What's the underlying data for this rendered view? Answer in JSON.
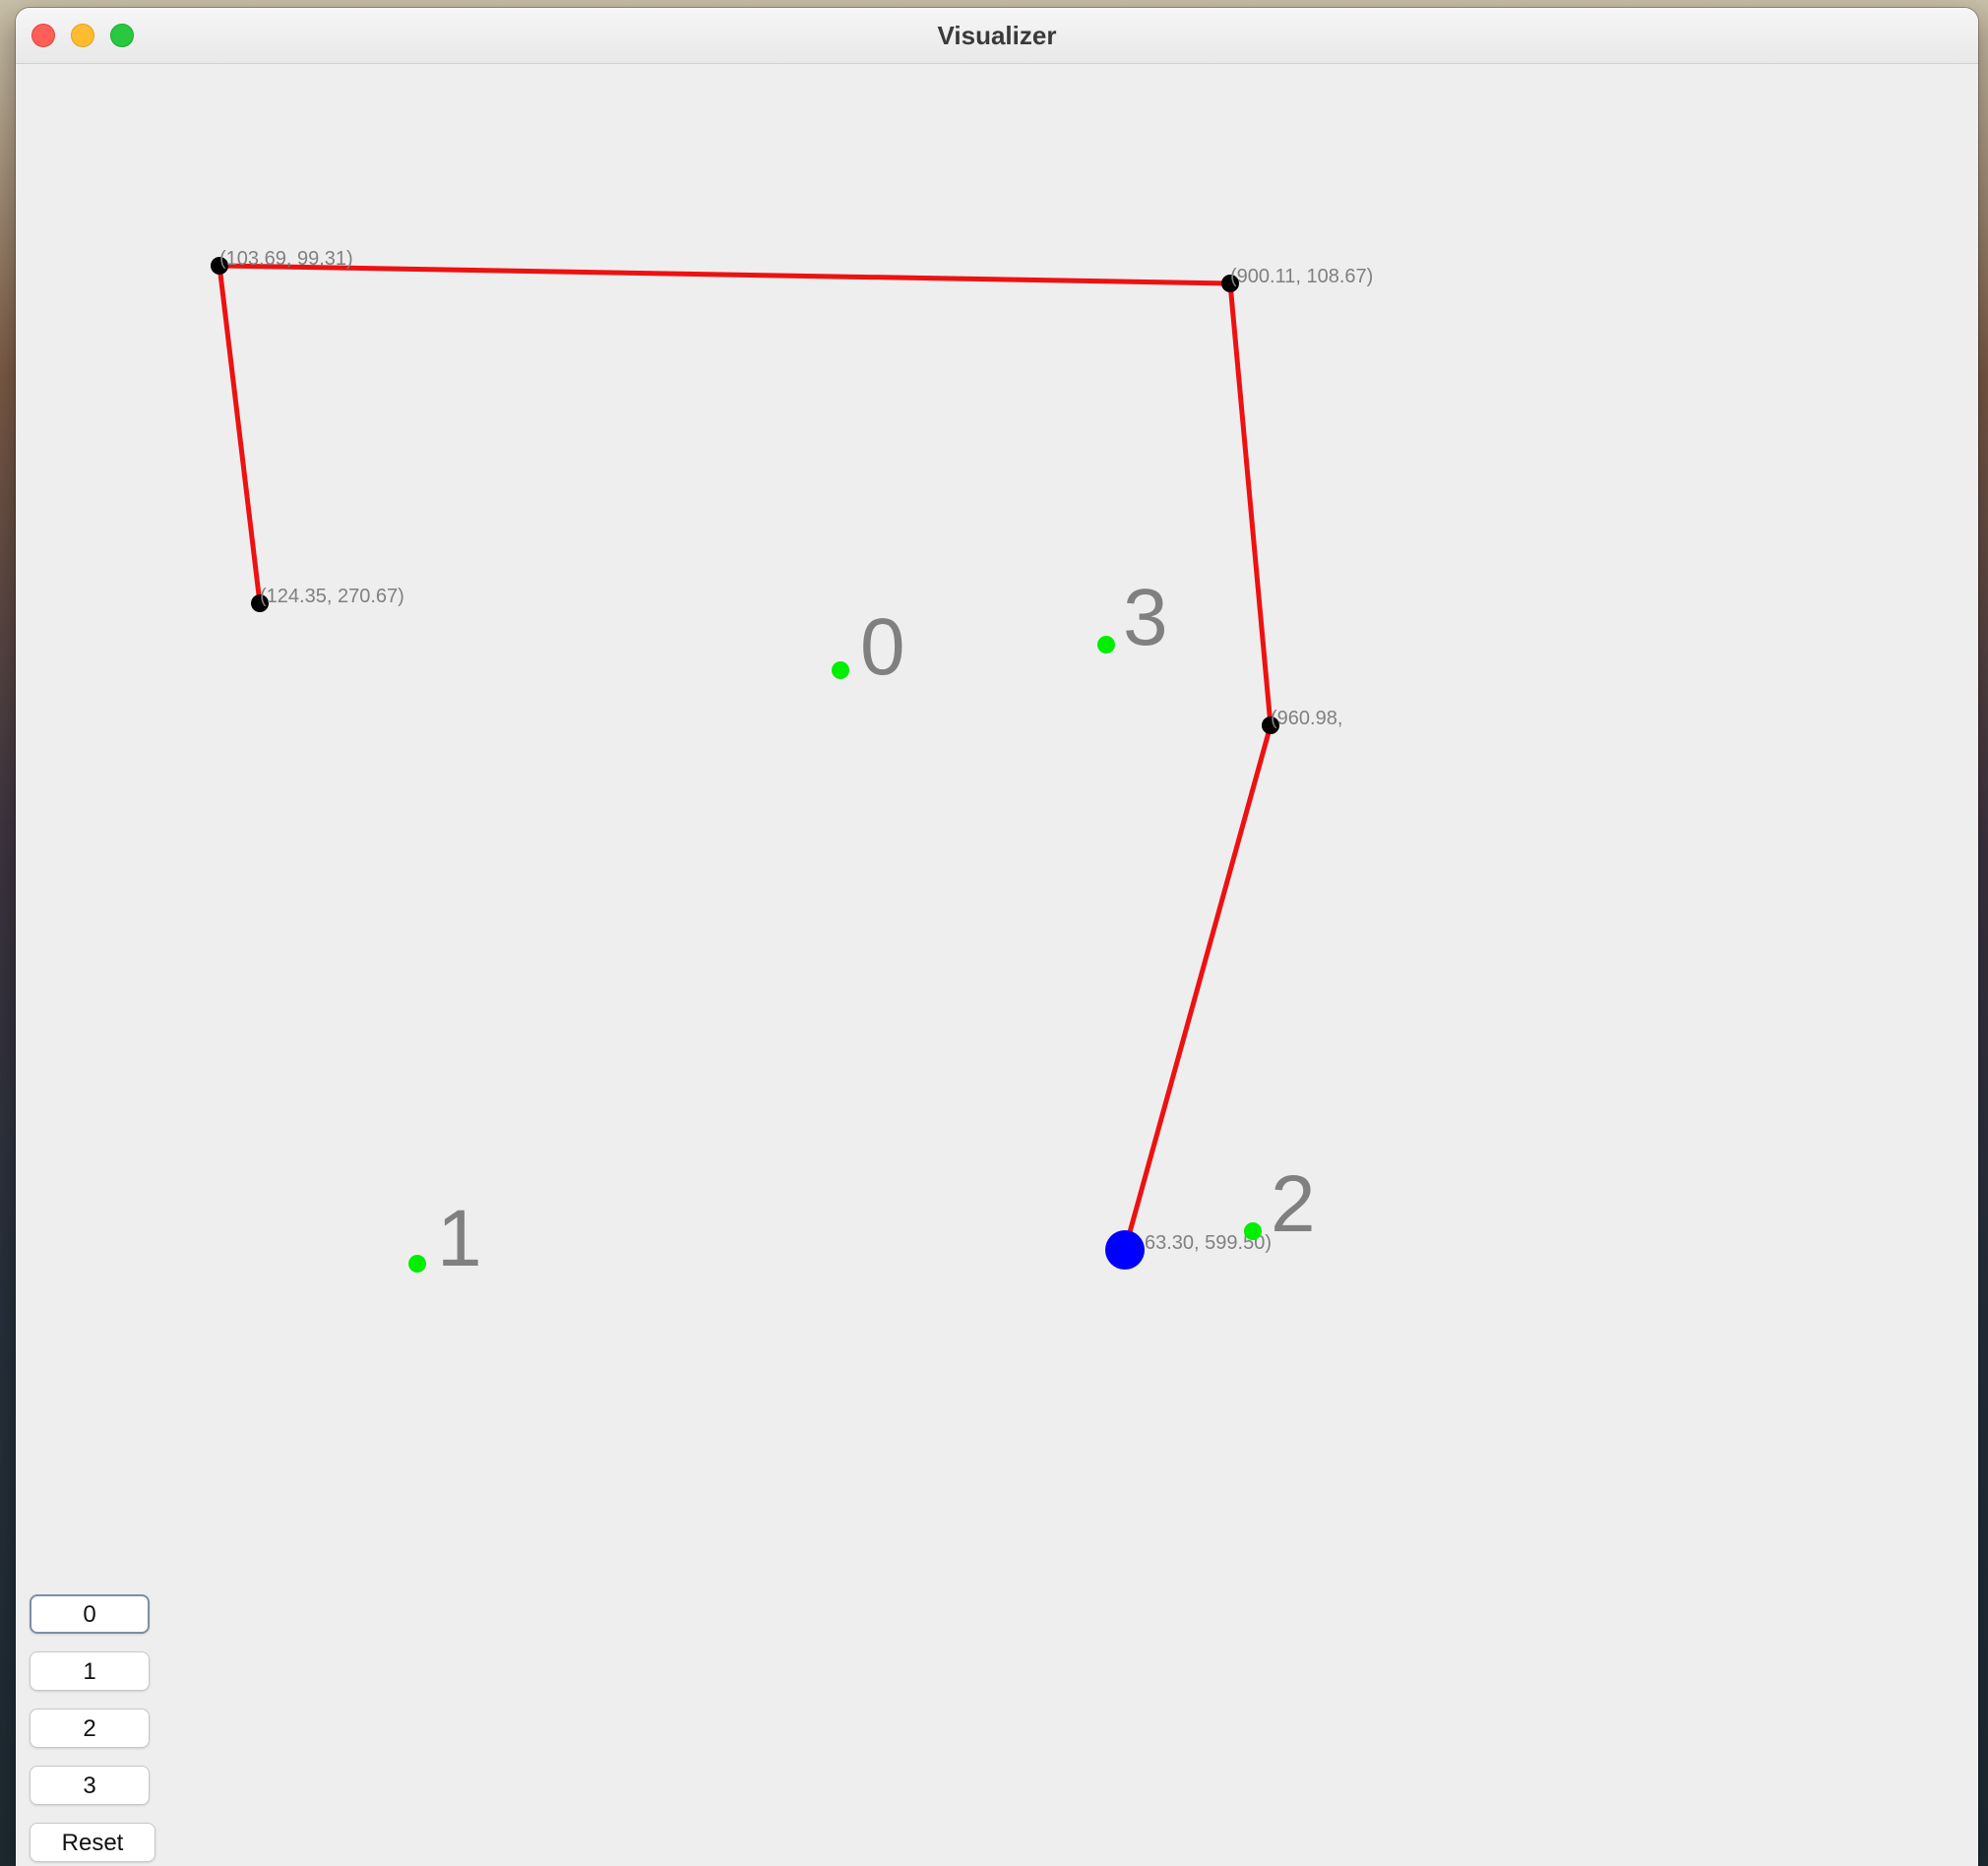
{
  "window": {
    "title": "Visualizer"
  },
  "colors": {
    "path": "#ee1111",
    "joint": "#000000",
    "effector": "#0000ff",
    "target": "#00ee00",
    "label": "#808080"
  },
  "path_joints": [
    {
      "label": "(124.35, 270.67)"
    },
    {
      "label": "(103.69, 99.31)"
    },
    {
      "label": "(900.11, 108.67)"
    },
    {
      "label": "(960.98,"
    },
    {
      "label": "63.30, 599.50)",
      "end_effector": true
    }
  ],
  "targets": [
    {
      "label": "0"
    },
    {
      "label": "1"
    },
    {
      "label": "2"
    },
    {
      "label": "3"
    }
  ],
  "buttons": [
    {
      "label": "0",
      "focused": true
    },
    {
      "label": "1"
    },
    {
      "label": "2"
    },
    {
      "label": "3"
    },
    {
      "label": "Reset"
    }
  ]
}
